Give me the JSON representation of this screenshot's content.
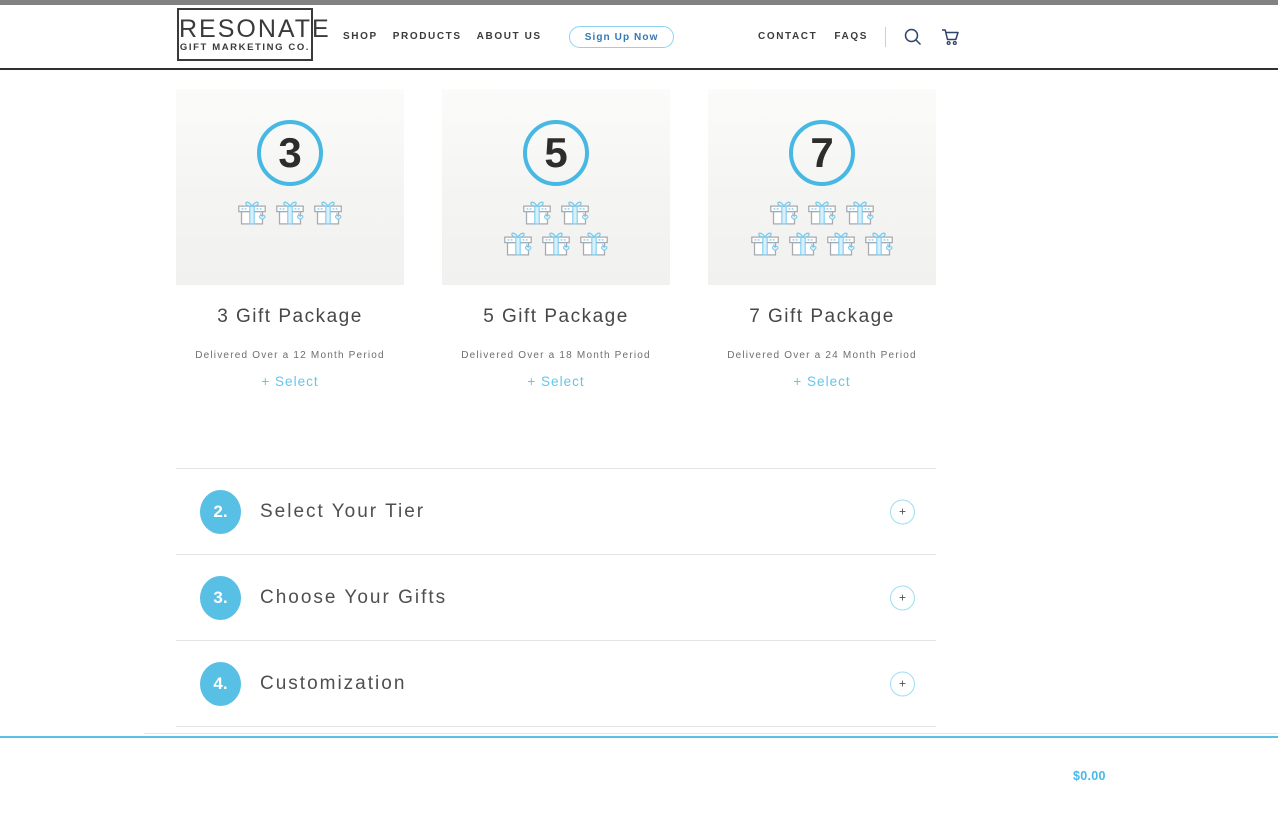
{
  "header": {
    "logo": {
      "line1": "RESONATE",
      "line2": "GIFT MARKETING CO."
    },
    "nav_left": [
      {
        "label": "SHOP"
      },
      {
        "label": "PRODUCTS"
      },
      {
        "label": "ABOUT US"
      }
    ],
    "signup_label": "Sign Up Now",
    "nav_right": [
      {
        "label": "CONTACT"
      },
      {
        "label": "FAQS"
      }
    ],
    "icons": {
      "search": "search-icon",
      "cart": "cart-icon"
    }
  },
  "packages": [
    {
      "count": "3",
      "title": "3 Gift Package",
      "subtitle": "Delivered Over a 12 Month Period",
      "select_label": "+ Select",
      "gift_rows": [
        3
      ]
    },
    {
      "count": "5",
      "title": "5 Gift Package",
      "subtitle": "Delivered Over a 18 Month Period",
      "select_label": "+ Select",
      "gift_rows": [
        2,
        3
      ]
    },
    {
      "count": "7",
      "title": "7 Gift Package",
      "subtitle": "Delivered Over a 24 Month Period",
      "select_label": "+ Select",
      "gift_rows": [
        3,
        4
      ]
    }
  ],
  "steps": [
    {
      "number": "2.",
      "title": "Select Your Tier",
      "toggle": "+"
    },
    {
      "number": "3.",
      "title": "Choose Your Gifts",
      "toggle": "+"
    },
    {
      "number": "4.",
      "title": "Customization",
      "toggle": "+"
    }
  ],
  "footer": {
    "total": "$0.00"
  },
  "colors": {
    "accent_blue": "#47b8e4",
    "badge_blue": "#58bfe5",
    "select_link_blue": "#66c5ea",
    "signup_text_blue": "#3279b5",
    "signup_border_blue": "#8ed4f0",
    "icon_navy": "#2e4369",
    "text_dark": "#3b3b3b",
    "rule_blue": "#58c1e8"
  }
}
